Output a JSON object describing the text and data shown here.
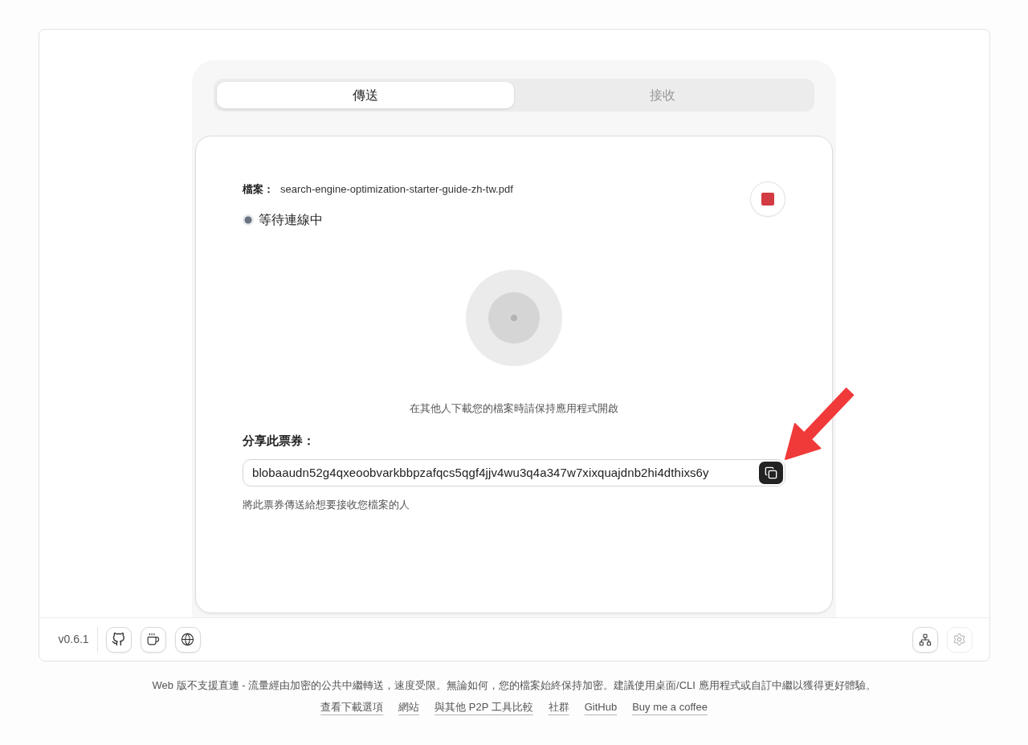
{
  "tabs": [
    {
      "label": "傳送",
      "selected": true
    },
    {
      "label": "接收",
      "selected": false
    }
  ],
  "file": {
    "label": "檔案：",
    "name": "search-engine-optimization-starter-guide-zh-tw.pdf"
  },
  "status": {
    "text": "等待連線中"
  },
  "hint": "在其他人下載您的檔案時請保持應用程式開啟",
  "ticket": {
    "label": "分享此票券：",
    "value": "blobaaudn52g4qxeoobvarkbbpzafqcs5qgf4jjv4wu3q4a347w7xixquajdnb2hi4dthixs6y",
    "help": "將此票券傳送給想要接收您檔案的人"
  },
  "bottom_bar": {
    "version": "v0.6.1",
    "settings_button": {
      "disabled": true
    }
  },
  "footer": {
    "notice": "Web 版不支援直連 - 流量經由加密的公共中繼轉送，速度受限。無論如何，您的檔案始終保持加密。建議使用桌面/CLI 應用程式或自訂中繼以獲得更好體驗。",
    "links": [
      "查看下載選項",
      "網站",
      "與其他 P2P 工具比較",
      "社群",
      "GitHub",
      "Buy me a coffee"
    ]
  }
}
